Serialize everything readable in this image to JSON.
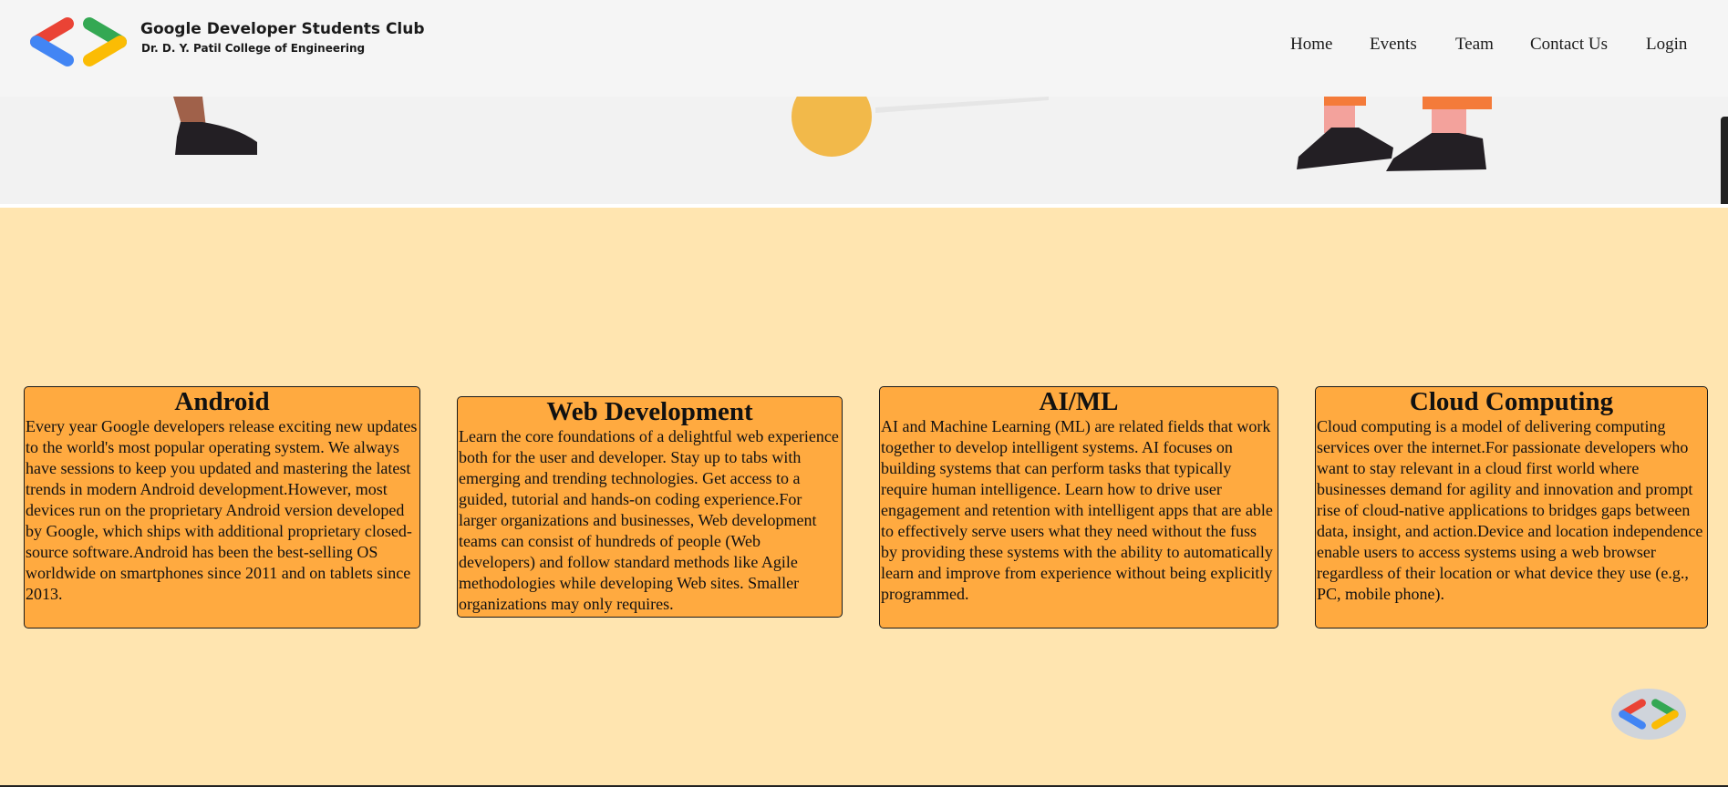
{
  "brand": {
    "title": "Google Developer Students Club",
    "subtitle": "Dr. D. Y. Patil College of Engineering"
  },
  "nav": {
    "items": [
      "Home",
      "Events",
      "Team",
      "Contact Us",
      "Login"
    ]
  },
  "cards": [
    {
      "title": "Android",
      "body": "Every year Google developers release exciting new updates to the world's most popular operating system. We always have sessions to keep you updated and mastering the latest trends in modern Android development.However, most devices run on the proprietary Android version developed by Google, which ships with additional proprietary closed-source software.Android has been the best-selling OS worldwide on smartphones since 2011 and on tablets since 2013."
    },
    {
      "title": "Web Development",
      "body": "Learn the core foundations of a delightful web experience both for the user and developer. Stay up to tabs with emerging and trending technologies. Get access to a guided, tutorial and hands-on coding experience.For larger organizations and businesses, Web development teams can consist of hundreds of people (Web developers) and follow standard methods like Agile methodologies while developing Web sites. Smaller organizations may only requires."
    },
    {
      "title": "AI/ML",
      "body": "AI and Machine Learning (ML) are related fields that work together to develop intelligent systems. AI focuses on building systems that can perform tasks that typically require human intelligence. Learn how to drive user engagement and retention with intelligent apps that are able to effectively serve users what they need without the fuss by providing these systems with the ability to automatically learn and improve from experience without being explicitly programmed."
    },
    {
      "title": "Cloud Computing",
      "body": "Cloud computing is a model of delivering computing services over the internet.For passionate developers who want to stay relevant in a cloud first world where businesses demand for agility and innovation and prompt rise of cloud-native applications to bridges gaps between data, insight, and action.Device and location independence enable users to access systems using a web browser regardless of their location or what device they use (e.g., PC, mobile phone)."
    }
  ],
  "colors": {
    "page_bg": "#ffe5b0",
    "card_bg": "#ffaa40",
    "navbar_bg": "#f5f5f5",
    "google_red": "#ea4335",
    "google_blue": "#4285f4",
    "google_green": "#34a853",
    "google_yellow": "#fbbc04"
  }
}
